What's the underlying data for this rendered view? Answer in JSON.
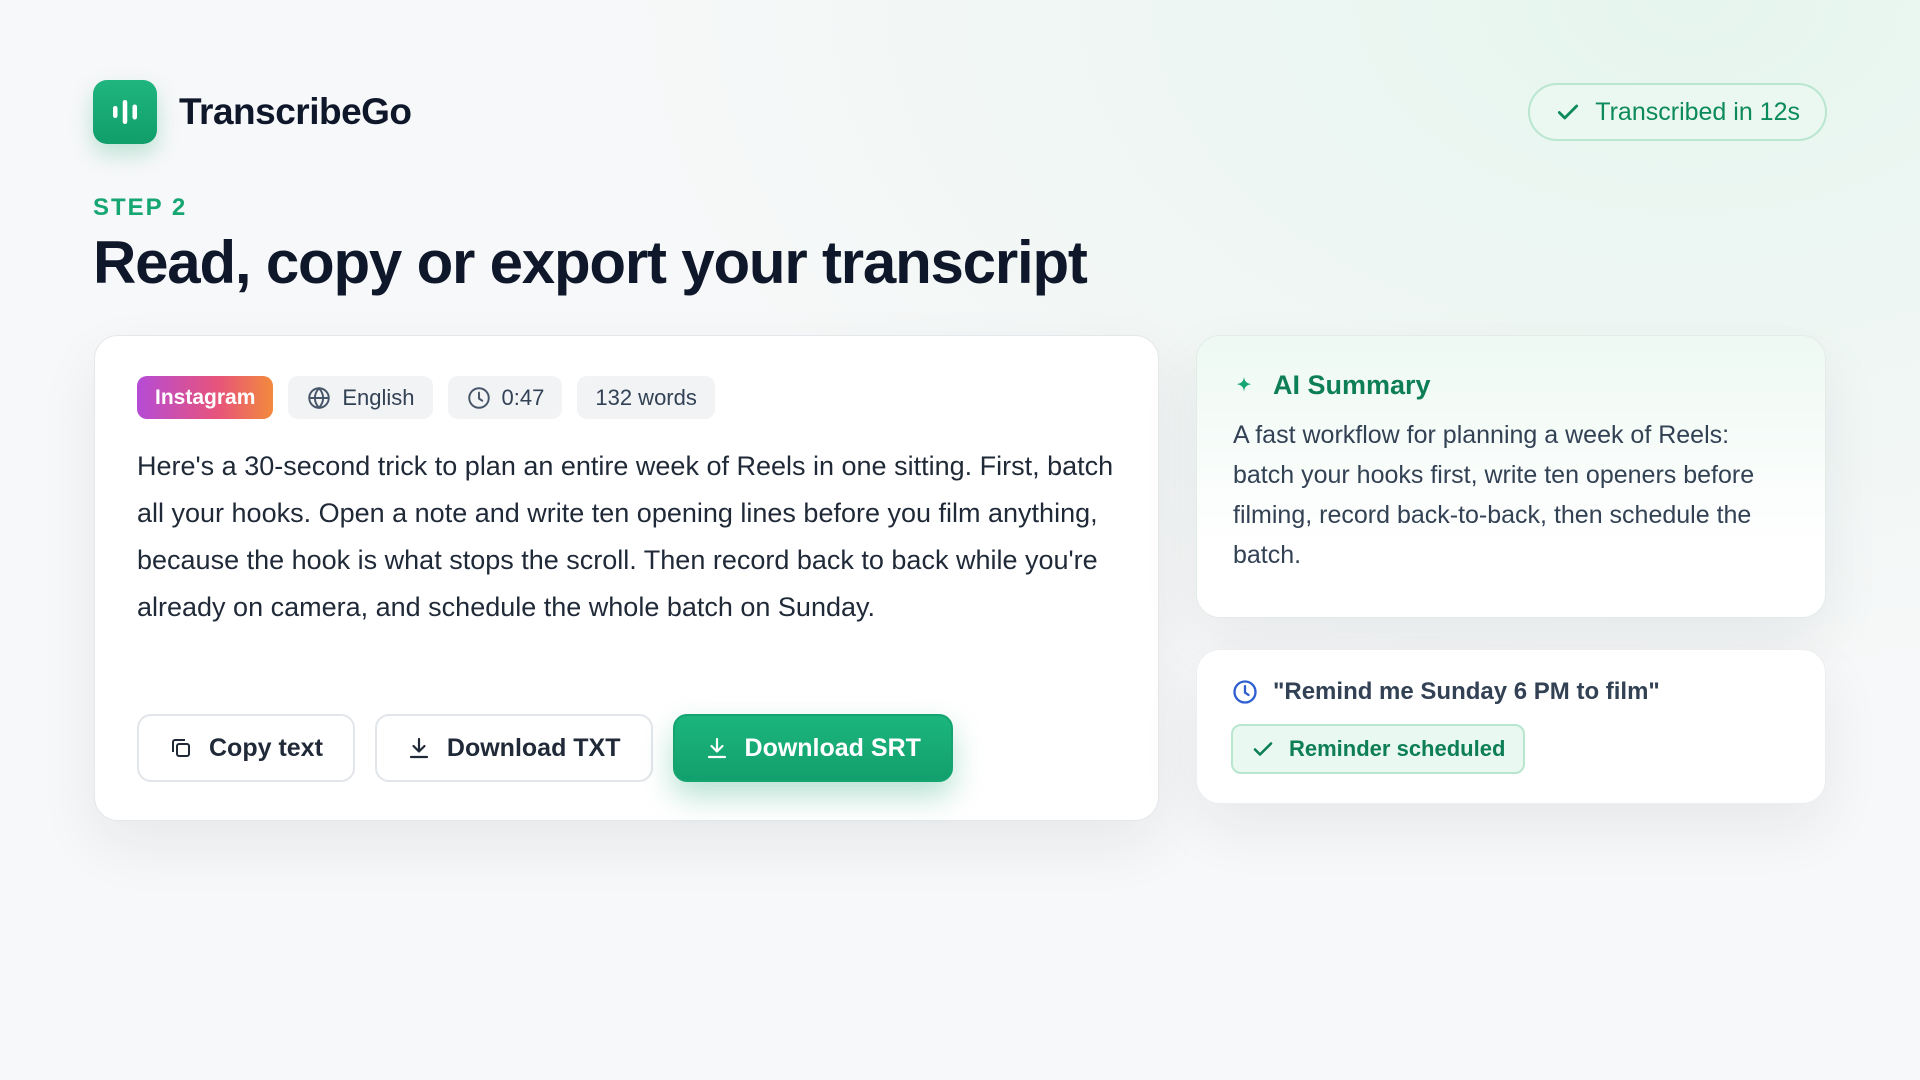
{
  "app": {
    "name": "TranscribeGo",
    "status": "Transcribed in 12s"
  },
  "page": {
    "step": "STEP 2",
    "title": "Read, copy or export your transcript"
  },
  "transcript": {
    "platform": "Instagram",
    "language": "English",
    "duration": "0:47",
    "word_count": "132 words",
    "text": "Here's a 30-second trick to plan an entire week of Reels in one sitting. First, batch all your hooks. Open a note and write ten opening lines before you film anything, because the hook is what stops the scroll. Then record back to back while you're already on camera, and schedule the whole batch on Sunday.",
    "actions": {
      "copy": "Copy text",
      "download_txt": "Download TXT",
      "download_srt": "Download SRT"
    }
  },
  "summary": {
    "title": "AI Summary",
    "text": "A fast workflow for planning a week of Reels: batch your hooks first, write ten openers before filming, record back-to-back, then schedule the batch."
  },
  "reminder": {
    "request": "\"Remind me Sunday 6 PM to film\"",
    "status": "Reminder scheduled"
  },
  "colors": {
    "accent": "#16a672",
    "accent_dark": "#0d7e55",
    "text": "#0f172a",
    "instagram_gradient": [
      "#b54bd6",
      "#e8547a",
      "#f28a3c"
    ]
  },
  "icons": {
    "logo": "audio-wave-icon",
    "status": "check-icon",
    "language": "globe-icon",
    "duration": "clock-icon",
    "copy": "copy-icon",
    "download": "download-icon",
    "summary": "sparkle-icon",
    "reminder": "clock-icon",
    "reminder_status": "check-icon"
  }
}
